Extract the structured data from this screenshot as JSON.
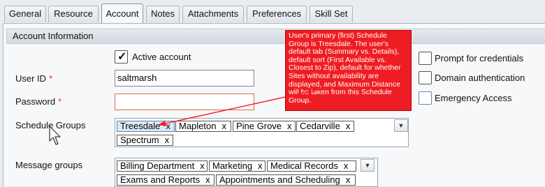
{
  "tabs": [
    {
      "label": "General",
      "active": false
    },
    {
      "label": "Resource",
      "active": false
    },
    {
      "label": "Account",
      "active": true
    },
    {
      "label": "Notes",
      "active": false
    },
    {
      "label": "Attachments",
      "active": false
    },
    {
      "label": "Preferences",
      "active": false
    },
    {
      "label": "Skill Set",
      "active": false
    }
  ],
  "section": {
    "title": "Account Information"
  },
  "active_account": {
    "label": "Active account",
    "checked": true
  },
  "user_id": {
    "label": "User ID",
    "required_mark": "*",
    "value": "saltmarsh"
  },
  "password": {
    "label": "Password",
    "required_mark": "*",
    "value": ""
  },
  "schedule_groups": {
    "label": "Schedule Groups",
    "chips": [
      {
        "name": "Treesdale",
        "remove": "x"
      },
      {
        "name": "Mapleton",
        "remove": "x"
      },
      {
        "name": "Pine Grove",
        "remove": "x"
      },
      {
        "name": "Cedarville",
        "remove": "x"
      },
      {
        "name": "Spectrum",
        "remove": "x"
      }
    ],
    "dropdown_icon": "chevron-down-icon"
  },
  "message_groups": {
    "label": "Message groups",
    "chips": [
      {
        "name": "Billing Department",
        "remove": "x"
      },
      {
        "name": "Marketing",
        "remove": "x"
      },
      {
        "name": "Medical Records",
        "remove": "x"
      },
      {
        "name": "Exams and Reports",
        "remove": "x"
      },
      {
        "name": "Appointments and Scheduling",
        "remove": "x"
      }
    ],
    "dropdown_icon": "chevron-down-icon"
  },
  "options": [
    {
      "label": "Prompt for credentials",
      "checked": false
    },
    {
      "label": "Domain authentication",
      "checked": false
    },
    {
      "label": "Emergency Access",
      "checked": false
    }
  ],
  "callout": {
    "text": "User's primary (first) Schedule Group is Treesdale.  The user's default tab (Summary vs. Details), default sort (First Available vs. Closest to Zip), default for whether Sites without availability are displayed, and Maximum Distance will be taken from this Schedule Group."
  },
  "colors": {
    "callout_bg": "#ee1d23",
    "required_mark": "#e0401a",
    "selected_chip_bg": "#dbe8f6"
  }
}
